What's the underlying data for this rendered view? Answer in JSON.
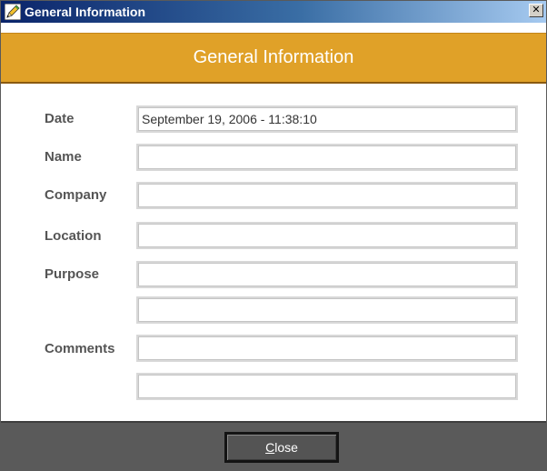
{
  "window": {
    "title": "General Information",
    "close_glyph": "✕",
    "icon": "pencil-icon"
  },
  "header": {
    "title": "General Information",
    "color": "#e0a128"
  },
  "form": {
    "date": {
      "label": "Date",
      "value": "September 19, 2006 - 11:38:10"
    },
    "name": {
      "label": "Name",
      "value": ""
    },
    "company": {
      "label": "Company",
      "value": ""
    },
    "location": {
      "label": "Location",
      "value": ""
    },
    "purpose": {
      "label": "Purpose",
      "value_line1": "",
      "value_line2": ""
    },
    "comments": {
      "label": "Comments",
      "value_line1": "",
      "value_line2": ""
    }
  },
  "footer": {
    "close_button": {
      "mnemonic": "C",
      "rest": "lose"
    }
  }
}
